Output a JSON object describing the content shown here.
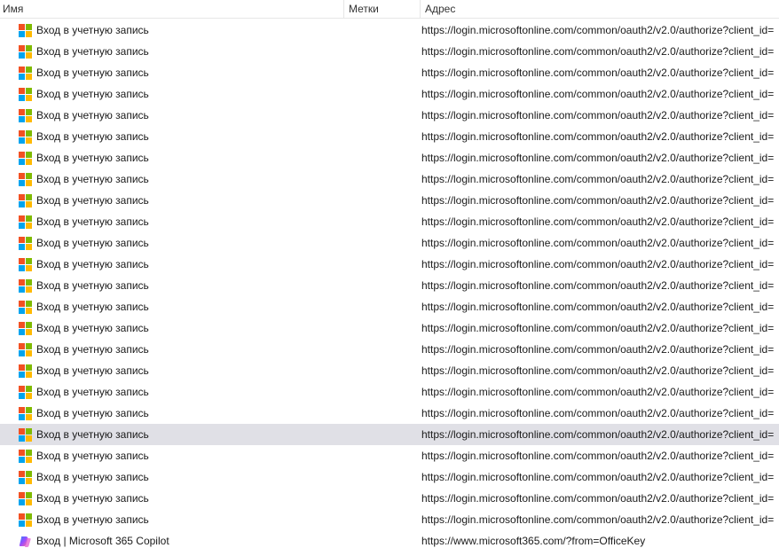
{
  "columns": {
    "name": "Имя",
    "tags": "Метки",
    "address": "Адрес"
  },
  "selected_index": 19,
  "rows": [
    {
      "title": "Вход в учетную запись",
      "url": "https://login.microsoftonline.com/common/oauth2/v2.0/authorize?client_id=",
      "icon": "microsoft-logo-icon"
    },
    {
      "title": "Вход в учетную запись",
      "url": "https://login.microsoftonline.com/common/oauth2/v2.0/authorize?client_id=",
      "icon": "microsoft-logo-icon"
    },
    {
      "title": "Вход в учетную запись",
      "url": "https://login.microsoftonline.com/common/oauth2/v2.0/authorize?client_id=",
      "icon": "microsoft-logo-icon"
    },
    {
      "title": "Вход в учетную запись",
      "url": "https://login.microsoftonline.com/common/oauth2/v2.0/authorize?client_id=",
      "icon": "microsoft-logo-icon"
    },
    {
      "title": "Вход в учетную запись",
      "url": "https://login.microsoftonline.com/common/oauth2/v2.0/authorize?client_id=",
      "icon": "microsoft-logo-icon"
    },
    {
      "title": "Вход в учетную запись",
      "url": "https://login.microsoftonline.com/common/oauth2/v2.0/authorize?client_id=",
      "icon": "microsoft-logo-icon"
    },
    {
      "title": "Вход в учетную запись",
      "url": "https://login.microsoftonline.com/common/oauth2/v2.0/authorize?client_id=",
      "icon": "microsoft-logo-icon"
    },
    {
      "title": "Вход в учетную запись",
      "url": "https://login.microsoftonline.com/common/oauth2/v2.0/authorize?client_id=",
      "icon": "microsoft-logo-icon"
    },
    {
      "title": "Вход в учетную запись",
      "url": "https://login.microsoftonline.com/common/oauth2/v2.0/authorize?client_id=",
      "icon": "microsoft-logo-icon"
    },
    {
      "title": "Вход в учетную запись",
      "url": "https://login.microsoftonline.com/common/oauth2/v2.0/authorize?client_id=",
      "icon": "microsoft-logo-icon"
    },
    {
      "title": "Вход в учетную запись",
      "url": "https://login.microsoftonline.com/common/oauth2/v2.0/authorize?client_id=",
      "icon": "microsoft-logo-icon"
    },
    {
      "title": "Вход в учетную запись",
      "url": "https://login.microsoftonline.com/common/oauth2/v2.0/authorize?client_id=",
      "icon": "microsoft-logo-icon"
    },
    {
      "title": "Вход в учетную запись",
      "url": "https://login.microsoftonline.com/common/oauth2/v2.0/authorize?client_id=",
      "icon": "microsoft-logo-icon"
    },
    {
      "title": "Вход в учетную запись",
      "url": "https://login.microsoftonline.com/common/oauth2/v2.0/authorize?client_id=",
      "icon": "microsoft-logo-icon"
    },
    {
      "title": "Вход в учетную запись",
      "url": "https://login.microsoftonline.com/common/oauth2/v2.0/authorize?client_id=",
      "icon": "microsoft-logo-icon"
    },
    {
      "title": "Вход в учетную запись",
      "url": "https://login.microsoftonline.com/common/oauth2/v2.0/authorize?client_id=",
      "icon": "microsoft-logo-icon"
    },
    {
      "title": "Вход в учетную запись",
      "url": "https://login.microsoftonline.com/common/oauth2/v2.0/authorize?client_id=",
      "icon": "microsoft-logo-icon"
    },
    {
      "title": "Вход в учетную запись",
      "url": "https://login.microsoftonline.com/common/oauth2/v2.0/authorize?client_id=",
      "icon": "microsoft-logo-icon"
    },
    {
      "title": "Вход в учетную запись",
      "url": "https://login.microsoftonline.com/common/oauth2/v2.0/authorize?client_id=",
      "icon": "microsoft-logo-icon"
    },
    {
      "title": "Вход в учетную запись",
      "url": "https://login.microsoftonline.com/common/oauth2/v2.0/authorize?client_id=",
      "icon": "microsoft-logo-icon"
    },
    {
      "title": "Вход в учетную запись",
      "url": "https://login.microsoftonline.com/common/oauth2/v2.0/authorize?client_id=",
      "icon": "microsoft-logo-icon"
    },
    {
      "title": "Вход в учетную запись",
      "url": "https://login.microsoftonline.com/common/oauth2/v2.0/authorize?client_id=",
      "icon": "microsoft-logo-icon"
    },
    {
      "title": "Вход в учетную запись",
      "url": "https://login.microsoftonline.com/common/oauth2/v2.0/authorize?client_id=",
      "icon": "microsoft-logo-icon"
    },
    {
      "title": "Вход в учетную запись",
      "url": "https://login.microsoftonline.com/common/oauth2/v2.0/authorize?client_id=",
      "icon": "microsoft-logo-icon"
    },
    {
      "title": "Вход | Microsoft 365 Copilot",
      "url": "https://www.microsoft365.com/?from=OfficeKey",
      "icon": "copilot-logo-icon"
    }
  ],
  "colors": {
    "ms_red": "#f25022",
    "ms_green": "#7fba00",
    "ms_blue": "#00a4ef",
    "ms_yellow": "#ffb900",
    "selected_row": "#e0e0e6"
  }
}
